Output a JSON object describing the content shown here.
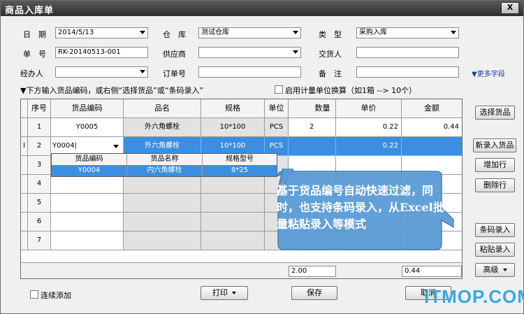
{
  "window": {
    "title": "商品入库单",
    "close_label": "X"
  },
  "form": {
    "date_label": "日　期",
    "date_value": "2014/5/13",
    "warehouse_label": "仓　库",
    "warehouse_value": "测试仓库",
    "type_label": "类　型",
    "type_value": "采购入库",
    "doc_no_label": "单　号",
    "doc_no_value": "RK-20140513-001",
    "supplier_label": "供应商",
    "supplier_value": "",
    "deliverer_label": "交货人",
    "deliverer_value": "",
    "handler_label": "经办人",
    "handler_value": "",
    "order_no_label": "订单号",
    "order_no_value": "",
    "remark_label": "备　注",
    "remark_value": "",
    "more_fields": "▼更多字段"
  },
  "hint": "▼下方输入货品编码，或右侧“选择货品”或“条码录入”",
  "unit_conversion_label": "启用计量单位换算（如1箱 --> 10个）",
  "table": {
    "headers": [
      "序号",
      "货品编码",
      "品名",
      "规格",
      "单位",
      "数量",
      "单价",
      "金额"
    ],
    "rows": [
      {
        "no": "1",
        "code": "Y0005",
        "name": "外六角螺栓",
        "spec": "10*100",
        "unit": "PCS",
        "qty": "2",
        "price": "0.22",
        "amount": "0.44"
      },
      {
        "marker": "I",
        "no": "2",
        "code": "Y0004|",
        "name": "外六角螺栓",
        "spec": "10*100",
        "unit": "PCS",
        "qty": "",
        "price": "0.22",
        "amount": ""
      },
      {
        "no": "3"
      },
      {
        "no": "4"
      },
      {
        "no": "5"
      },
      {
        "no": "6"
      },
      {
        "no": "7"
      }
    ],
    "total_qty": "2.00",
    "total_amount": "0.44"
  },
  "dropdown": {
    "headers": [
      "货品编码",
      "货品名称",
      "规格型号"
    ],
    "row": [
      "Y0004",
      "内六角螺栓",
      "8*25"
    ]
  },
  "callout": "基于货品编号自动快速过滤，同时，也支持条码录入，从Excel批量粘贴录入等模式",
  "side_buttons": {
    "select_goods": "选择货品",
    "new_goods": "新录入货品",
    "add_row": "增加行",
    "delete_row": "删除行",
    "barcode_entry": "条码录入",
    "paste_entry": "粘贴录入",
    "advanced": "高级"
  },
  "footer": {
    "continuous_add": "连续添加",
    "print": "打印",
    "save": "保存",
    "cancel": "取消"
  },
  "watermark": "ITMOP.COM",
  "colors": {
    "selection": "#3c8fe0",
    "callout": "#5b9bd5",
    "watermark": "#3aa7e0"
  }
}
